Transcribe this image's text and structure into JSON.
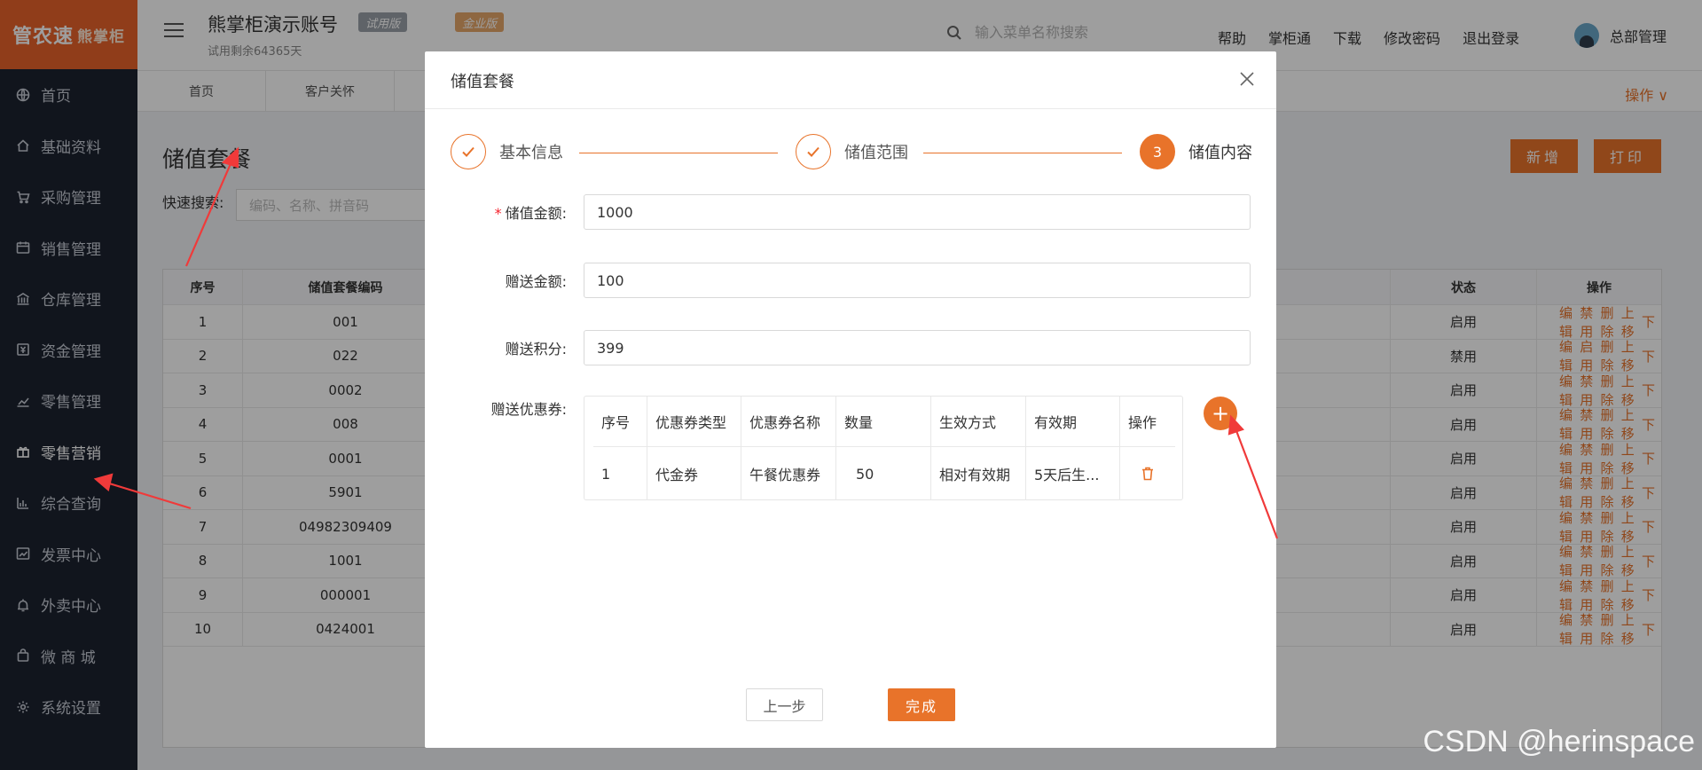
{
  "sidebar": {
    "logo": "管农速",
    "logo_sub": "熊掌柜",
    "items": [
      {
        "label": "首页"
      },
      {
        "label": "基础资料"
      },
      {
        "label": "采购管理"
      },
      {
        "label": "销售管理"
      },
      {
        "label": "仓库管理"
      },
      {
        "label": "资金管理"
      },
      {
        "label": "零售管理"
      },
      {
        "label": "零售营销"
      },
      {
        "label": "综合查询"
      },
      {
        "label": "发票中心"
      },
      {
        "label": "外卖中心"
      },
      {
        "label": "微 商 城"
      },
      {
        "label": "系统设置"
      }
    ]
  },
  "header": {
    "account": "熊掌柜演示账号",
    "badge_trial": "试用版",
    "badge_flag": "金业版",
    "trial_days": "试用剩余64365天",
    "search_placeholder": "输入菜单名称搜索",
    "links": [
      "帮助",
      "掌柜通",
      "下载",
      "修改密码",
      "退出登录"
    ],
    "user": "总部管理"
  },
  "tabs": [
    "首页",
    "客户关怀"
  ],
  "operations_label": "操作 ∨",
  "page": {
    "title": "储值套餐",
    "quick_search_label": "快速搜索:",
    "quick_search_placeholder": "编码、名称、拼音码",
    "btn_add": "新增",
    "btn_print": "打印"
  },
  "table": {
    "headers": {
      "seq": "序号",
      "code": "储值套餐编码",
      "status": "状态",
      "ops": "操作"
    },
    "rows": [
      {
        "seq": "1",
        "code": "001",
        "status": "启用",
        "ops": [
          "编辑",
          "禁用",
          "删除",
          "上移",
          "下"
        ]
      },
      {
        "seq": "2",
        "code": "022",
        "status": "禁用",
        "ops": [
          "编辑",
          "启用",
          "删除",
          "上移",
          "下"
        ]
      },
      {
        "seq": "3",
        "code": "0002",
        "status": "启用",
        "ops": [
          "编辑",
          "禁用",
          "删除",
          "上移",
          "下"
        ]
      },
      {
        "seq": "4",
        "code": "008",
        "status": "启用",
        "ops": [
          "编辑",
          "禁用",
          "删除",
          "上移",
          "下"
        ]
      },
      {
        "seq": "5",
        "code": "0001",
        "status": "启用",
        "ops": [
          "编辑",
          "禁用",
          "删除",
          "上移",
          "下"
        ]
      },
      {
        "seq": "6",
        "code": "5901",
        "status": "启用",
        "ops": [
          "编辑",
          "禁用",
          "删除",
          "上移",
          "下"
        ]
      },
      {
        "seq": "7",
        "code": "04982309409",
        "status": "启用",
        "ops": [
          "编辑",
          "禁用",
          "删除",
          "上移",
          "下"
        ]
      },
      {
        "seq": "8",
        "code": "1001",
        "status": "启用",
        "ops": [
          "编辑",
          "禁用",
          "删除",
          "上移",
          "下"
        ]
      },
      {
        "seq": "9",
        "code": "000001",
        "status": "启用",
        "ops": [
          "编辑",
          "禁用",
          "删除",
          "上移",
          "下"
        ]
      },
      {
        "seq": "10",
        "code": "0424001",
        "status": "启用",
        "ops": [
          "编辑",
          "禁用",
          "删除",
          "上移",
          "下"
        ]
      }
    ]
  },
  "modal": {
    "title": "储值套餐",
    "steps": [
      "基本信息",
      "储值范围",
      "储值内容"
    ],
    "current_step_number": "3",
    "fields": {
      "amount_label": "储值金额:",
      "amount_value": "1000",
      "gift_amount_label": "赠送金额:",
      "gift_amount_value": "100",
      "gift_points_label": "赠送积分:",
      "gift_points_value": "399",
      "coupon_label": "赠送优惠券:"
    },
    "coupon_table": {
      "headers": [
        "序号",
        "优惠券类型",
        "优惠券名称",
        "数量",
        "生效方式",
        "有效期",
        "操作"
      ],
      "rows": [
        {
          "seq": "1",
          "type": "代金券",
          "name": "午餐优惠券",
          "qty": "50",
          "mode": "相对有效期",
          "validity": "5天后生..."
        }
      ]
    },
    "add_symbol": "+",
    "btn_prev": "上一步",
    "btn_done": "完成"
  },
  "watermark": "CSDN @herinspace",
  "colors": {
    "accent": "#e8732a",
    "sidebar_bg": "#1c2230",
    "logo_bg": "#e8632a",
    "annotation": "#f03a3a"
  }
}
